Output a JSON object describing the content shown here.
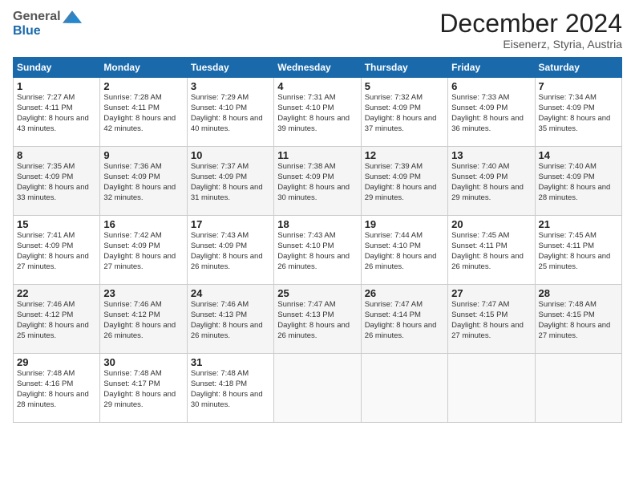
{
  "header": {
    "logo_general": "General",
    "logo_blue": "Blue",
    "title": "December 2024",
    "subtitle": "Eisenerz, Styria, Austria"
  },
  "calendar": {
    "days_of_week": [
      "Sunday",
      "Monday",
      "Tuesday",
      "Wednesday",
      "Thursday",
      "Friday",
      "Saturday"
    ],
    "weeks": [
      [
        null,
        null,
        null,
        null,
        null,
        null,
        null
      ]
    ],
    "cells": [
      [
        {
          "day": 1,
          "sunrise": "7:27 AM",
          "sunset": "4:11 PM",
          "daylight": "8 hours and 43 minutes."
        },
        {
          "day": 2,
          "sunrise": "7:28 AM",
          "sunset": "4:11 PM",
          "daylight": "8 hours and 42 minutes."
        },
        {
          "day": 3,
          "sunrise": "7:29 AM",
          "sunset": "4:10 PM",
          "daylight": "8 hours and 40 minutes."
        },
        {
          "day": 4,
          "sunrise": "7:31 AM",
          "sunset": "4:10 PM",
          "daylight": "8 hours and 39 minutes."
        },
        {
          "day": 5,
          "sunrise": "7:32 AM",
          "sunset": "4:09 PM",
          "daylight": "8 hours and 37 minutes."
        },
        {
          "day": 6,
          "sunrise": "7:33 AM",
          "sunset": "4:09 PM",
          "daylight": "8 hours and 36 minutes."
        },
        {
          "day": 7,
          "sunrise": "7:34 AM",
          "sunset": "4:09 PM",
          "daylight": "8 hours and 35 minutes."
        }
      ],
      [
        {
          "day": 8,
          "sunrise": "7:35 AM",
          "sunset": "4:09 PM",
          "daylight": "8 hours and 33 minutes."
        },
        {
          "day": 9,
          "sunrise": "7:36 AM",
          "sunset": "4:09 PM",
          "daylight": "8 hours and 32 minutes."
        },
        {
          "day": 10,
          "sunrise": "7:37 AM",
          "sunset": "4:09 PM",
          "daylight": "8 hours and 31 minutes."
        },
        {
          "day": 11,
          "sunrise": "7:38 AM",
          "sunset": "4:09 PM",
          "daylight": "8 hours and 30 minutes."
        },
        {
          "day": 12,
          "sunrise": "7:39 AM",
          "sunset": "4:09 PM",
          "daylight": "8 hours and 29 minutes."
        },
        {
          "day": 13,
          "sunrise": "7:40 AM",
          "sunset": "4:09 PM",
          "daylight": "8 hours and 29 minutes."
        },
        {
          "day": 14,
          "sunrise": "7:40 AM",
          "sunset": "4:09 PM",
          "daylight": "8 hours and 28 minutes."
        }
      ],
      [
        {
          "day": 15,
          "sunrise": "7:41 AM",
          "sunset": "4:09 PM",
          "daylight": "8 hours and 27 minutes."
        },
        {
          "day": 16,
          "sunrise": "7:42 AM",
          "sunset": "4:09 PM",
          "daylight": "8 hours and 27 minutes."
        },
        {
          "day": 17,
          "sunrise": "7:43 AM",
          "sunset": "4:09 PM",
          "daylight": "8 hours and 26 minutes."
        },
        {
          "day": 18,
          "sunrise": "7:43 AM",
          "sunset": "4:10 PM",
          "daylight": "8 hours and 26 minutes."
        },
        {
          "day": 19,
          "sunrise": "7:44 AM",
          "sunset": "4:10 PM",
          "daylight": "8 hours and 26 minutes."
        },
        {
          "day": 20,
          "sunrise": "7:45 AM",
          "sunset": "4:11 PM",
          "daylight": "8 hours and 26 minutes."
        },
        {
          "day": 21,
          "sunrise": "7:45 AM",
          "sunset": "4:11 PM",
          "daylight": "8 hours and 25 minutes."
        }
      ],
      [
        {
          "day": 22,
          "sunrise": "7:46 AM",
          "sunset": "4:12 PM",
          "daylight": "8 hours and 25 minutes."
        },
        {
          "day": 23,
          "sunrise": "7:46 AM",
          "sunset": "4:12 PM",
          "daylight": "8 hours and 26 minutes."
        },
        {
          "day": 24,
          "sunrise": "7:46 AM",
          "sunset": "4:13 PM",
          "daylight": "8 hours and 26 minutes."
        },
        {
          "day": 25,
          "sunrise": "7:47 AM",
          "sunset": "4:13 PM",
          "daylight": "8 hours and 26 minutes."
        },
        {
          "day": 26,
          "sunrise": "7:47 AM",
          "sunset": "4:14 PM",
          "daylight": "8 hours and 26 minutes."
        },
        {
          "day": 27,
          "sunrise": "7:47 AM",
          "sunset": "4:15 PM",
          "daylight": "8 hours and 27 minutes."
        },
        {
          "day": 28,
          "sunrise": "7:48 AM",
          "sunset": "4:15 PM",
          "daylight": "8 hours and 27 minutes."
        }
      ],
      [
        {
          "day": 29,
          "sunrise": "7:48 AM",
          "sunset": "4:16 PM",
          "daylight": "8 hours and 28 minutes."
        },
        {
          "day": 30,
          "sunrise": "7:48 AM",
          "sunset": "4:17 PM",
          "daylight": "8 hours and 29 minutes."
        },
        {
          "day": 31,
          "sunrise": "7:48 AM",
          "sunset": "4:18 PM",
          "daylight": "8 hours and 30 minutes."
        },
        null,
        null,
        null,
        null
      ]
    ]
  }
}
